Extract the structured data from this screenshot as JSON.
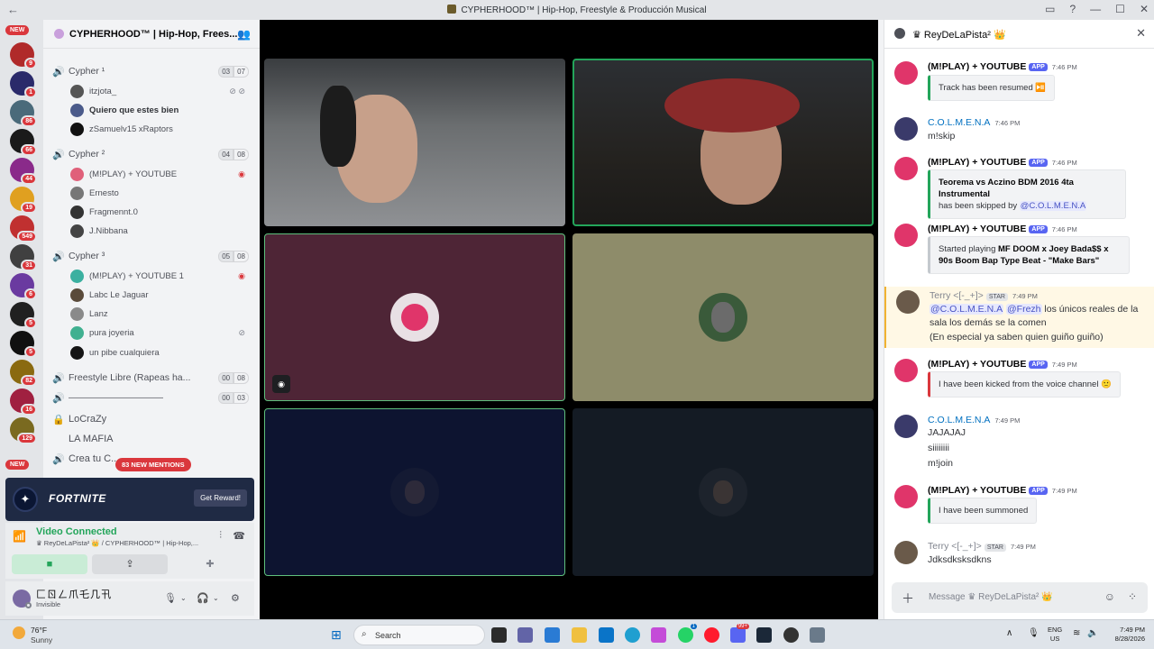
{
  "window": {
    "title": "CYPHERHOOD™ | Hip-Hop, Freestyle & Producción Musical",
    "back_glyph": "←",
    "controls": [
      "▭",
      "?",
      "—",
      "☐",
      "✕"
    ]
  },
  "server_rail": {
    "new_label_top": "NEW",
    "new_label_bottom": "NEW",
    "badges": [
      "9",
      "1",
      "86",
      "66",
      "44",
      "19",
      "549",
      "31",
      "6",
      "5",
      "5",
      "82",
      "16",
      "129"
    ]
  },
  "guild": {
    "name": "CYPHERHOOD™ | Hip-Hop, Frees...",
    "chevron": "⌄",
    "invite_icon": "👥"
  },
  "channels": {
    "cypher1": {
      "name": "Cypher ¹",
      "count_a": "03",
      "count_b": "07"
    },
    "cypher1_users": [
      {
        "name": "itzjota_"
      },
      {
        "name": "Quiero que estes bien"
      },
      {
        "name": "zSamuelv15 xRaptors"
      }
    ],
    "cypher2": {
      "name": "Cypher ²",
      "count_a": "04",
      "count_b": "08"
    },
    "cypher2_users": [
      {
        "name": "(M!PLAY) + YOUTUBE"
      },
      {
        "name": "Ernesto"
      },
      {
        "name": "Fragmennt.0"
      },
      {
        "name": "J.Nibbana"
      }
    ],
    "cypher3": {
      "name": "Cypher ³",
      "count_a": "05",
      "count_b": "08"
    },
    "cypher3_users": [
      {
        "name": "(M!PLAY) + YOUTUBE 1"
      },
      {
        "name": "Labc Le Jaguar"
      },
      {
        "name": "Lanz"
      },
      {
        "name": "pura joyeria"
      },
      {
        "name": "un pibe cualquiera"
      }
    ],
    "freestyle": {
      "name": "Freestyle Libre (Rapeas ha...",
      "count_a": "00",
      "count_b": "08"
    },
    "divider": {
      "name": "——————————",
      "count_a": "00",
      "count_b": "03"
    },
    "crazy": {
      "name": "LoCraZy"
    },
    "mafia": {
      "name": "LA MAFIA"
    },
    "create": {
      "name": "Crea tu C..."
    }
  },
  "mentions_pill": "83 NEW MENTIONS",
  "promo": {
    "title": "FORTNITE",
    "button": "Get Reward!"
  },
  "voice_panel": {
    "status": "Video Connected",
    "location": "♛ ReyDeLaPista² 👑 / CYPHERHOOD™ | Hip-Hop,..."
  },
  "user_panel": {
    "name": "匚ㄖㄥ爪乇几卂",
    "status": "Invisible"
  },
  "chat": {
    "title": "♛ ReyDeLaPista² 👑",
    "composer_placeholder": "Message ♛ ReyDeLaPista² 👑",
    "messages": [
      {
        "author": "(M!PLAY) + YOUTUBE",
        "tag": "APP",
        "time": "7:46 PM",
        "embed": "Track has been resumed ⏯️"
      },
      {
        "author": "C.O.L.M.E.N.A",
        "time": "7:46 PM",
        "text": "m!skip"
      },
      {
        "author": "(M!PLAY) + YOUTUBE",
        "tag": "APP",
        "time": "7:46 PM",
        "embed_bold": "Teorema vs Aczino BDM 2016 4ta Instrumental",
        "embed_rest": "has been skipped by ",
        "embed_mention": "@C.O.L.M.E.N.A"
      },
      {
        "author": "(M!PLAY) + YOUTUBE",
        "tag": "APP",
        "time": "7:46 PM",
        "embed_pre": "Started playing ",
        "embed_bold": "MF DOOM x Joey Bada$$ x 90s Boom Bap Type Beat - \"Make Bars\""
      },
      {
        "author": "Terry <[-_+]>",
        "tag": "STAR",
        "time": "7:49 PM",
        "mention1": "@C.O.L.M.E.N.A",
        "mention2": "@Frezh",
        "text": " los únicos reales de la sala los demás se la comen",
        "text2": "(En especial ya saben quien guiño guiño)"
      },
      {
        "author": "(M!PLAY) + YOUTUBE",
        "tag": "APP",
        "time": "7:49 PM",
        "embed": "I have been kicked from the voice channel 🙁"
      },
      {
        "author": "C.O.L.M.E.N.A",
        "time": "7:49 PM",
        "lines": [
          "JAJAJAJ",
          "siiiiiiii",
          "m!join"
        ]
      },
      {
        "author": "(M!PLAY) + YOUTUBE",
        "tag": "APP",
        "time": "7:49 PM",
        "embed": "I have been summoned"
      },
      {
        "author": "Terry <[-_+]>",
        "tag": "STAR",
        "time": "7:49 PM",
        "text": "Jdksdksksdkns"
      }
    ]
  },
  "taskbar": {
    "temp": "76°F",
    "condition": "Sunny",
    "search": "Search",
    "lang1": "ENG",
    "lang2": "US",
    "time": "7:49 PM",
    "date": "8/28/2026",
    "notif_badge": "1",
    "discord_badge": "99+"
  },
  "colors": {
    "accent_green": "#23a55a",
    "mention_red": "#da373c",
    "app_tag": "#5865f2"
  }
}
